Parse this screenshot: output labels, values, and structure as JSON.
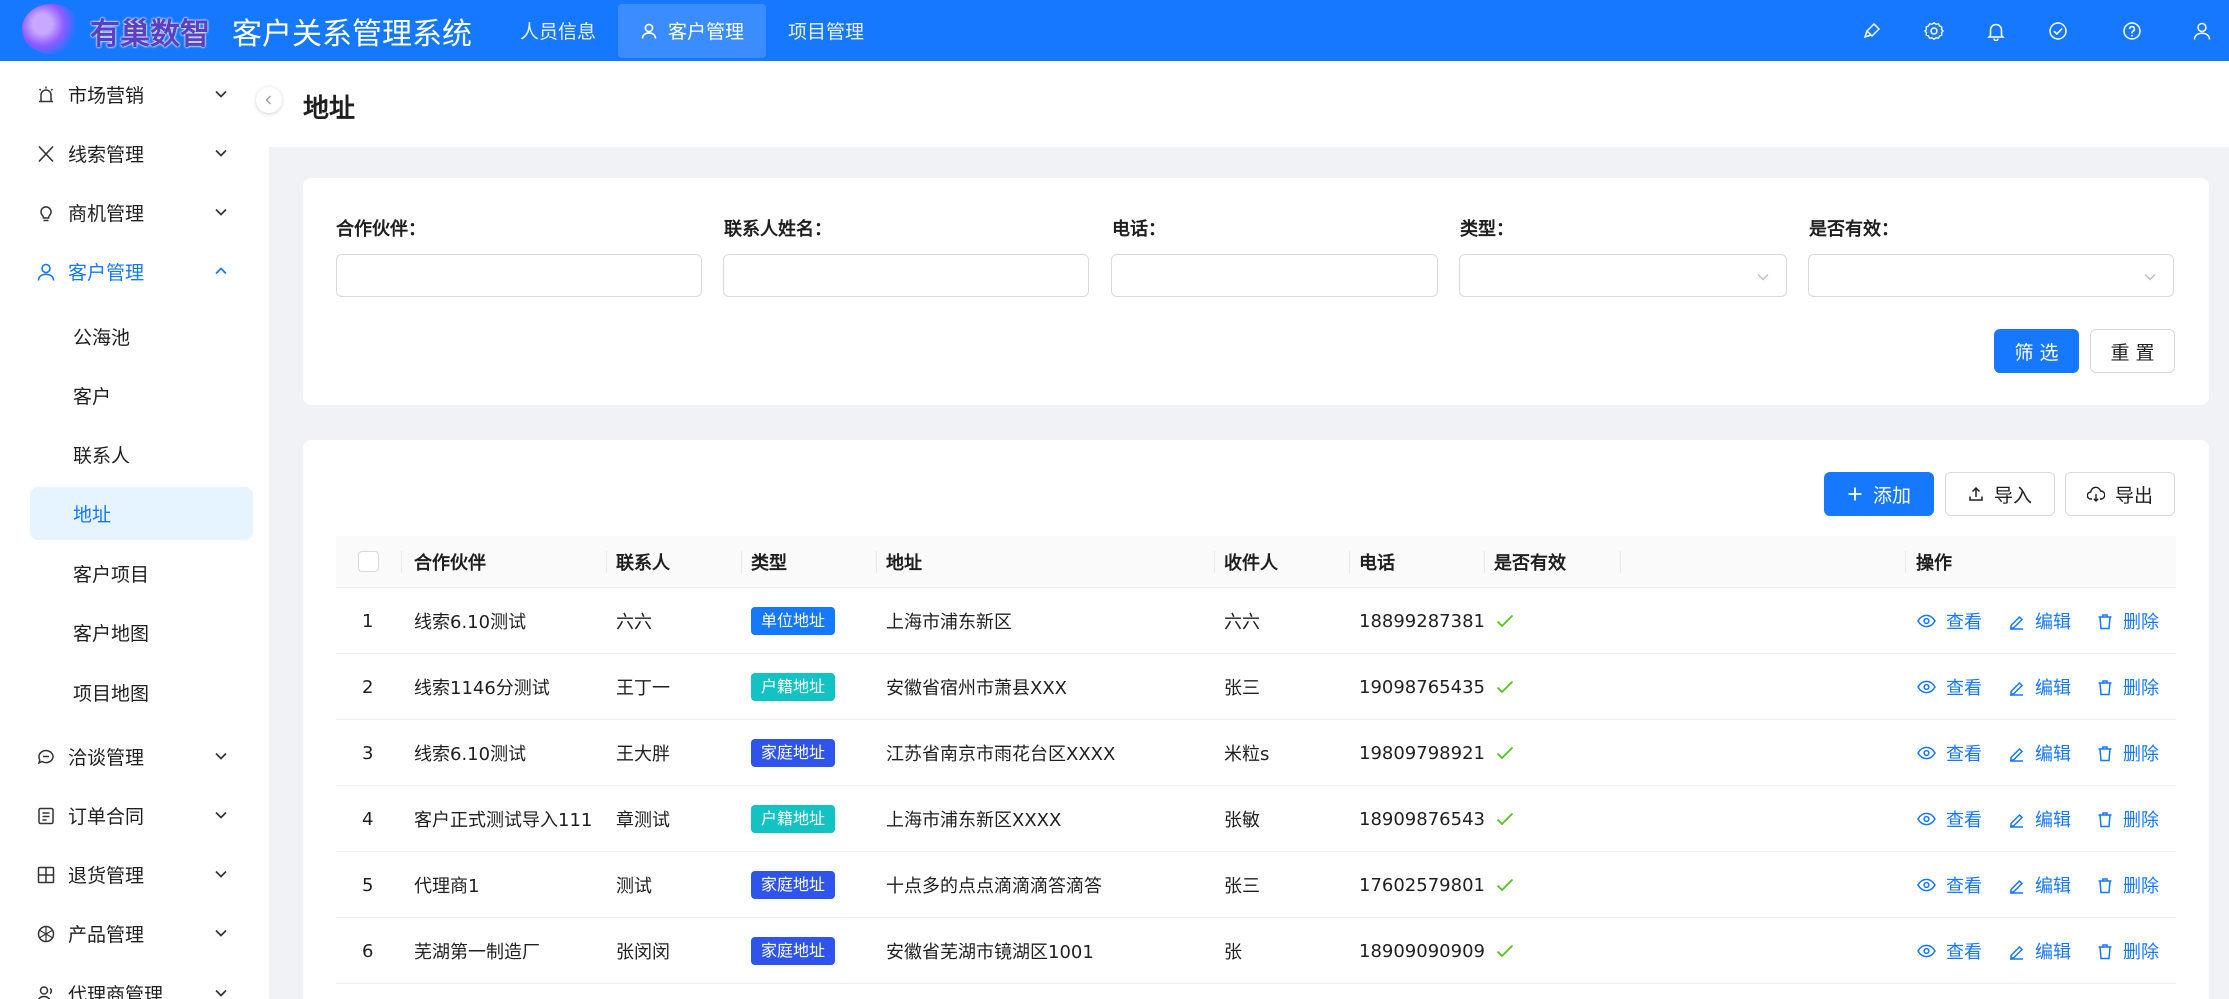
{
  "header": {
    "logo_text": "有巢数智",
    "app_title": "客户关系管理系统",
    "nav": [
      {
        "label": "人员信息",
        "active": false
      },
      {
        "label": "客户管理",
        "active": true
      },
      {
        "label": "项目管理",
        "active": false
      }
    ],
    "tools": [
      "brush-icon",
      "settings-icon",
      "bell-icon",
      "check-circle-icon",
      "question-circle-icon",
      "user-icon"
    ]
  },
  "sidebar": {
    "groups_top": [
      {
        "label": "市场营销",
        "icon": "alert-icon"
      },
      {
        "label": "线索管理",
        "icon": "x-icon"
      },
      {
        "label": "商机管理",
        "icon": "bulb-icon"
      },
      {
        "label": "客户管理",
        "icon": "user-icon",
        "open": true
      }
    ],
    "sub_items": [
      {
        "label": "公海池",
        "active": false
      },
      {
        "label": "客户",
        "active": false
      },
      {
        "label": "联系人",
        "active": false
      },
      {
        "label": "地址",
        "active": true
      },
      {
        "label": "客户项目",
        "active": false
      },
      {
        "label": "客户地图",
        "active": false
      },
      {
        "label": "项目地图",
        "active": false
      }
    ],
    "groups_bottom": [
      {
        "label": "洽谈管理",
        "icon": "chat-icon"
      },
      {
        "label": "订单合同",
        "icon": "order-icon"
      },
      {
        "label": "退货管理",
        "icon": "return-icon"
      },
      {
        "label": "产品管理",
        "icon": "product-icon"
      },
      {
        "label": "代理商管理",
        "icon": "agent-icon"
      }
    ]
  },
  "page": {
    "title": "地址"
  },
  "filters": {
    "labels": [
      "合作伙伴：",
      "联系人姓名：",
      "电话：",
      "类型：",
      "是否有效："
    ],
    "values": [
      "",
      "",
      "",
      "",
      ""
    ],
    "filter_button": "筛 选",
    "reset_button": "重 置"
  },
  "toolbar": {
    "add": "添加",
    "import": "导入",
    "export": "导出"
  },
  "table": {
    "columns": [
      "合作伙伴",
      "联系人",
      "类型",
      "地址",
      "收件人",
      "电话",
      "是否有效",
      "操作"
    ],
    "actions": [
      "查看",
      "编辑",
      "删除"
    ],
    "rows": [
      {
        "no": "1",
        "partner": "线索6.10测试",
        "contact": "六六",
        "type": "单位地址",
        "type_color": "#1677ff",
        "address": "上海市浦东新区",
        "receiver": "六六",
        "phone": "18899287381",
        "valid": true
      },
      {
        "no": "2",
        "partner": "线索1146分测试",
        "contact": "王丁一",
        "type": "户籍地址",
        "type_color": "#13c2c2",
        "address": "安徽省宿州市萧县XXX",
        "receiver": "张三",
        "phone": "19098765435",
        "valid": true
      },
      {
        "no": "3",
        "partner": "线索6.10测试",
        "contact": "王大胖",
        "type": "家庭地址",
        "type_color": "#2f54eb",
        "address": "江苏省南京市雨花台区XXXX",
        "receiver": "米粒s",
        "phone": "19809798921",
        "valid": true
      },
      {
        "no": "4",
        "partner": "客户正式测试导入111",
        "contact": "章测试",
        "type": "户籍地址",
        "type_color": "#13c2c2",
        "address": "上海市浦东新区XXXX",
        "receiver": "张敏",
        "phone": "18909876543",
        "valid": true
      },
      {
        "no": "5",
        "partner": "代理商1",
        "contact": "测试",
        "type": "家庭地址",
        "type_color": "#2f54eb",
        "address": "十点多的点点滴滴滴答滴答",
        "receiver": "张三",
        "phone": "17602579801",
        "valid": true
      },
      {
        "no": "6",
        "partner": "芜湖第一制造厂",
        "contact": "张闵闵",
        "type": "家庭地址",
        "type_color": "#2f54eb",
        "address": "安徽省芜湖市镜湖区1001",
        "receiver": "张",
        "phone": "18909090909",
        "valid": true
      }
    ]
  },
  "colors": {
    "primary": "#1677ff",
    "valid_check": "#52c41a"
  }
}
